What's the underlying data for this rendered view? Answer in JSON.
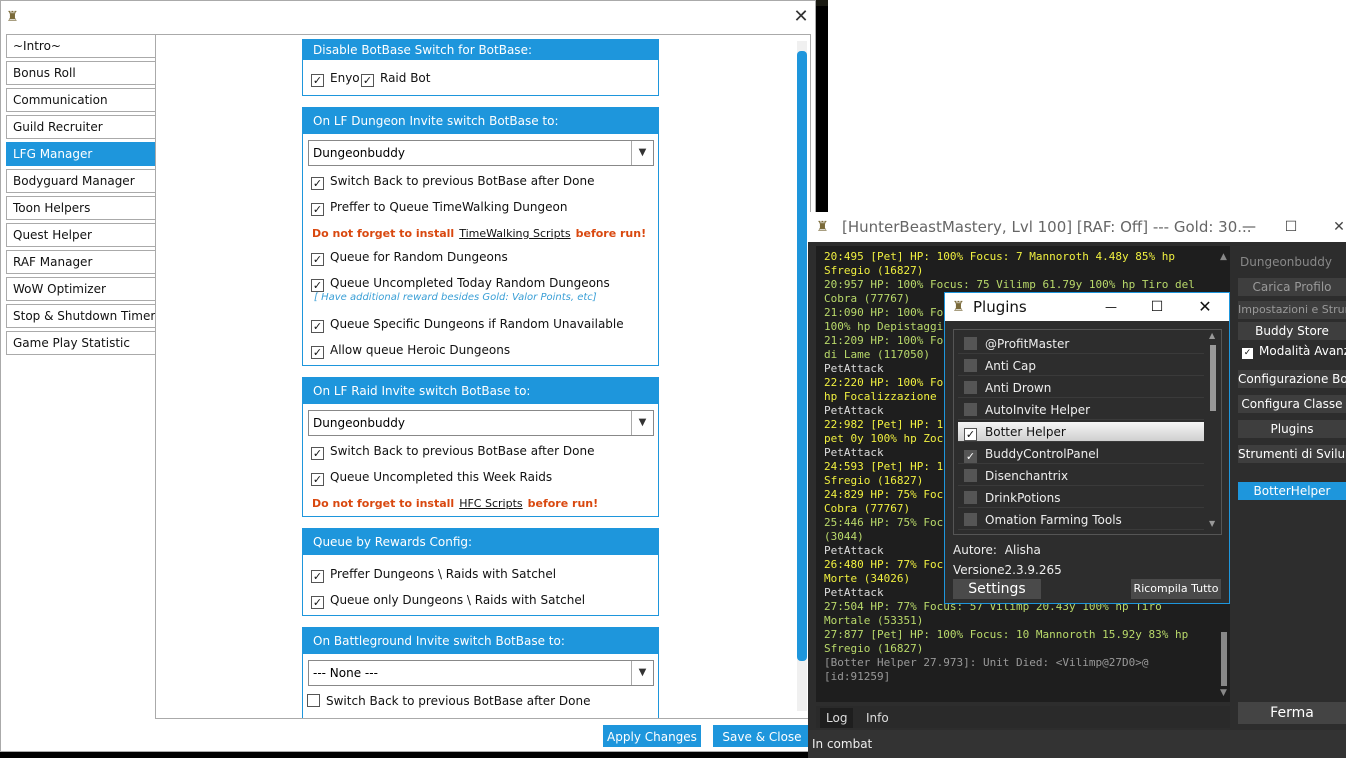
{
  "main_window": {
    "nav": [
      "~Intro~",
      "Bonus Roll",
      "Communication",
      "Guild Recruiter",
      "LFG Manager",
      "Bodyguard Manager",
      "Toon Helpers",
      "Quest Helper",
      "RAF Manager",
      "WoW Optimizer",
      "Stop & Shutdown Timers",
      "Game Play Statistic"
    ],
    "active_nav": "LFG Manager",
    "group_disable": {
      "title": "Disable BotBase Switch for BotBase:",
      "enyo": "Enyo",
      "raidbot": "Raid Bot"
    },
    "group_dungeon": {
      "title": "On LF Dungeon Invite switch BotBase to:",
      "dropdown": "Dungeonbuddy",
      "switch_back": "Switch Back to previous BotBase after Done",
      "preffer_tw": "Preffer to Queue TimeWalking Dungeon",
      "warn_pre": "Do not forget to install",
      "warn_link": "TimeWalking Scripts",
      "warn_post": "before run!",
      "queue_random": "Queue for Random Dungeons",
      "queue_uncompleted": "Queue Uncompleted Today Random Dungeons",
      "note": "[ Have additional reward besides Gold: Valor Points, etc]",
      "queue_specific": "Queue Specific Dungeons if Random Unavailable",
      "allow_heroic": "Allow queue Heroic Dungeons"
    },
    "group_raid": {
      "title": "On LF Raid Invite switch BotBase to:",
      "dropdown": "Dungeonbuddy",
      "switch_back": "Switch Back to previous BotBase after Done",
      "queue_week": "Queue Uncompleted this Week Raids",
      "warn_pre": "Do not forget to install",
      "warn_link": "HFC Scripts",
      "warn_post": "before run!"
    },
    "group_rewards": {
      "title": "Queue by Rewards Config:",
      "preffer_satchel": "Preffer Dungeons \\ Raids with Satchel",
      "only_satchel": "Queue only Dungeons \\ Raids with Satchel"
    },
    "group_bg": {
      "title": "On Battleground Invite switch BotBase to:",
      "dropdown": "--- None ---",
      "switch_back": "Switch Back to previous BotBase after Done"
    },
    "apply": "Apply Changes",
    "save_close": "Save & Close"
  },
  "hb_window": {
    "title": "[HunterBeastMastery, Lvl 100] [RAF: Off] --- Gold: 30...",
    "log_lines": [
      {
        "c": "log-yellow",
        "t": "20:495 [Pet] HP: 100% Focus: 7 Mannoroth 4.48y 85% hp"
      },
      {
        "c": "log-yellow",
        "t": "Sfregio (16827)"
      },
      {
        "c": "log-green",
        "t": "20:957 HP: 100% Focus: 75 Vilimp 61.79y 100% hp Tiro del"
      },
      {
        "c": "log-green",
        "t": "Cobra (77767)"
      },
      {
        "c": "log-green",
        "t": "21:090 HP: 100% Fo"
      },
      {
        "c": "log-green",
        "t": "100% hp Depistaggi"
      },
      {
        "c": "log-green",
        "t": "21:209 HP: 100% Fo"
      },
      {
        "c": "log-green",
        "t": "di Lame (117050)"
      },
      {
        "c": "log-white",
        "t": "PetAttack"
      },
      {
        "c": "log-yellow",
        "t": "22:220 HP: 100% Fo"
      },
      {
        "c": "log-yellow",
        "t": "hp Focalizzazione"
      },
      {
        "c": "log-white",
        "t": "PetAttack"
      },
      {
        "c": "log-yellow",
        "t": "22:982 [Pet] HP: 1"
      },
      {
        "c": "log-yellow",
        "t": "pet 0y 100% hp Zoc"
      },
      {
        "c": "log-white",
        "t": "PetAttack"
      },
      {
        "c": "log-yellow",
        "t": "24:593 [Pet] HP: 1"
      },
      {
        "c": "log-yellow",
        "t": "Sfregio (16827)"
      },
      {
        "c": "log-yellow",
        "t": "24:829 HP: 75% Foc"
      },
      {
        "c": "log-yellow",
        "t": "Cobra (77767)"
      },
      {
        "c": "log-green",
        "t": "25:446 HP: 75% Foc"
      },
      {
        "c": "log-green",
        "t": "(3044)"
      },
      {
        "c": "log-white",
        "t": "PetAttack"
      },
      {
        "c": "log-yellow",
        "t": "26:480 HP: 77% Foc"
      },
      {
        "c": "log-yellow",
        "t": "Morte (34026)"
      },
      {
        "c": "log-white",
        "t": "PetAttack"
      },
      {
        "c": "log-green",
        "t": "27:504 HP: 77% Focus: 57 Vilimp 20.43y 100% hp Tiro"
      },
      {
        "c": "log-green",
        "t": "Mortale (53351)"
      },
      {
        "c": "log-green",
        "t": "27:877 [Pet] HP: 100% Focus: 10 Mannoroth 15.92y 83% hp"
      },
      {
        "c": "log-green",
        "t": "Sfregio (16827)"
      },
      {
        "c": "log-grey",
        "t": "[Botter Helper 27.973]: Unit Died: <Vilimp@27D0>@"
      },
      {
        "c": "log-grey",
        "t": "[id:91259]"
      }
    ],
    "side": {
      "botbase": "Dungeonbuddy",
      "load_profile": "Carica Profilo",
      "settings_tools": "Impostazioni e Strumenti",
      "buddy_store": "Buddy Store",
      "advanced_mode": "Modalità Avanzata",
      "config_bot": "Configurazione Bot",
      "config_class": "Configura Classe",
      "plugins": "Plugins",
      "dev_tools": "Strumenti di Sviluppo",
      "botterhelper": "BotterHelper",
      "stop": "Ferma"
    },
    "tabs": [
      "Log",
      "Info"
    ],
    "status": "In combat"
  },
  "plugins_dialog": {
    "title": "Plugins",
    "items": [
      {
        "name": "@ProfitMaster",
        "checked": false
      },
      {
        "name": "Anti Cap",
        "checked": false
      },
      {
        "name": "Anti Drown",
        "checked": false
      },
      {
        "name": "AutoInvite Helper",
        "checked": false
      },
      {
        "name": "Botter Helper",
        "checked": true
      },
      {
        "name": "BuddyControlPanel",
        "checked": true
      },
      {
        "name": "Disenchantrix",
        "checked": false
      },
      {
        "name": "DrinkPotions",
        "checked": false
      },
      {
        "name": "Omation Farming Tools",
        "checked": false
      }
    ],
    "author_label": "Autore:",
    "author": "Alisha",
    "version": "Versione2.3.9.265",
    "settings": "Settings",
    "recompile": "Ricompila Tutto"
  },
  "glyphs": {
    "check": "✓",
    "close": "✕",
    "down": "▼",
    "min": "—",
    "max": "☐",
    "up": "▲"
  }
}
